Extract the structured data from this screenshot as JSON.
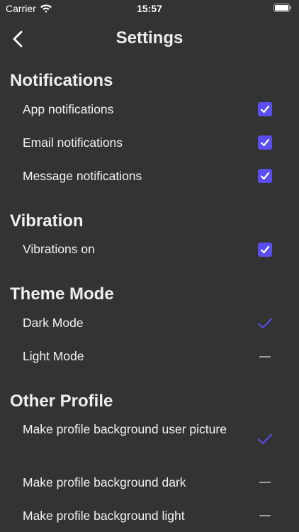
{
  "status_bar": {
    "carrier": "Carrier",
    "time": "15:57"
  },
  "nav": {
    "title": "Settings"
  },
  "sections": {
    "notifications": {
      "title": "Notifications",
      "items": [
        {
          "label": "App notifications",
          "state": "checked"
        },
        {
          "label": "Email notifications",
          "state": "checked"
        },
        {
          "label": "Message notifications",
          "state": "checked"
        }
      ]
    },
    "vibration": {
      "title": "Vibration",
      "items": [
        {
          "label": "Vibrations on",
          "state": "checked"
        }
      ]
    },
    "theme": {
      "title": "Theme Mode",
      "items": [
        {
          "label": "Dark Mode",
          "state": "selected"
        },
        {
          "label": "Light Mode",
          "state": "unselected"
        }
      ]
    },
    "other_profile": {
      "title": "Other Profile",
      "items": [
        {
          "label": "Make profile background user picture",
          "state": "selected"
        },
        {
          "label": "Make profile background dark",
          "state": "unselected"
        },
        {
          "label": "Make profile background light",
          "state": "unselected"
        }
      ]
    }
  },
  "colors": {
    "background": "#333333",
    "accent": "#5b4ef0",
    "dash": "#9d9d9d"
  }
}
